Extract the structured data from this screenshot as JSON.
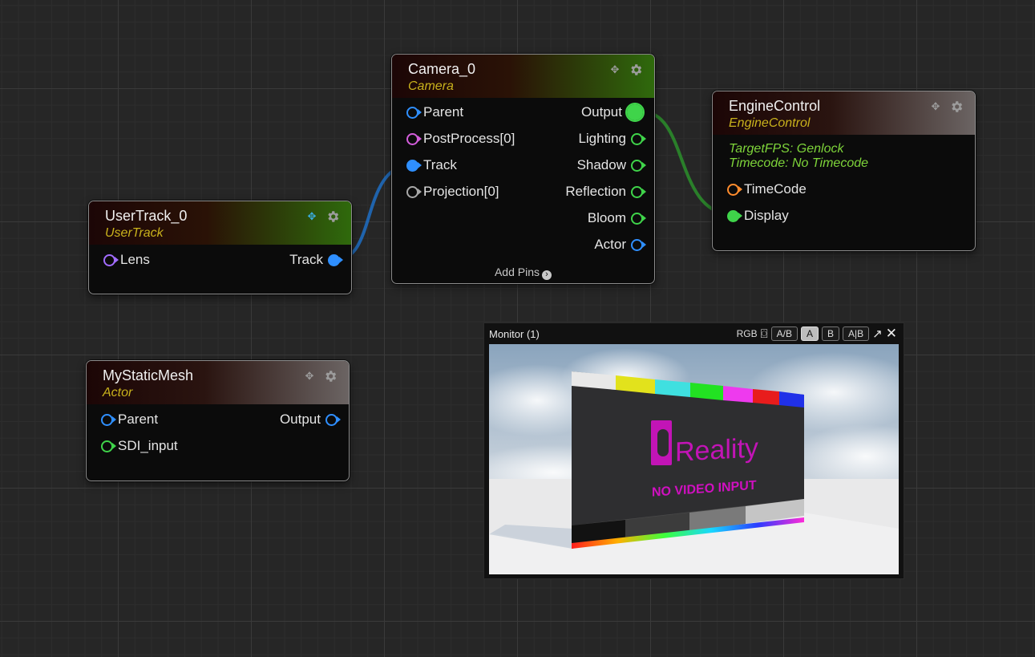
{
  "nodes": {
    "usertrack": {
      "title": "UserTrack_0",
      "type": "UserTrack",
      "pins_in": [
        {
          "label": "Lens",
          "color": "#a26cff"
        }
      ],
      "pins_out": [
        {
          "label": "Track",
          "color": "#2f8fff"
        }
      ]
    },
    "camera": {
      "title": "Camera_0",
      "type": "Camera",
      "pins_in": [
        {
          "label": "Parent",
          "color": "#2f8fff"
        },
        {
          "label": "PostProcess[0]",
          "color": "#d35ddb"
        },
        {
          "label": "Track",
          "color": "#2f8fff"
        },
        {
          "label": "Projection[0]",
          "color": "#a8a8a8"
        }
      ],
      "pins_out": [
        {
          "label": "Output",
          "color": "#3fd44a"
        },
        {
          "label": "Lighting",
          "color": "#3fd44a"
        },
        {
          "label": "Shadow",
          "color": "#3fd44a"
        },
        {
          "label": "Reflection",
          "color": "#3fd44a"
        },
        {
          "label": "Bloom",
          "color": "#3fd44a"
        },
        {
          "label": "Actor",
          "color": "#2f8fff"
        }
      ],
      "add_pins": "Add Pins"
    },
    "engine": {
      "title": "EngineControl",
      "type": "EngineControl",
      "status_fps": "TargetFPS: Genlock",
      "status_timecode": "Timecode: No Timecode",
      "pins_in": [
        {
          "label": "TimeCode",
          "color": "#ff8c2e"
        },
        {
          "label": "Display",
          "color": "#3fd44a"
        }
      ]
    },
    "mesh": {
      "title": "MyStaticMesh",
      "type": "Actor",
      "pins_in": [
        {
          "label": "Parent",
          "color": "#2f8fff"
        },
        {
          "label": "SDI_input",
          "color": "#3fd44a"
        }
      ],
      "pins_out": [
        {
          "label": "Output",
          "color": "#2f8fff"
        }
      ]
    }
  },
  "icons": {
    "move": "move-icon",
    "settings": "gear-icon",
    "compare_view": "screenshot-icon",
    "popout": "arrow-up-right-icon",
    "close": "close-icon"
  },
  "monitor": {
    "title": "Monitor (1)",
    "channel": "RGB",
    "buttons": [
      "A/B",
      "A",
      "B",
      "A|B"
    ],
    "active_button": "A",
    "screen_brand": "Reality",
    "screen_message": "NO VIDEO INPUT"
  },
  "colors": {
    "wire_blue": "#1f6fc4",
    "wire_green": "#2b8a2b",
    "brand_magenta": "#d010c0",
    "type_label": "#c9b21c",
    "status_text": "#7ed43a"
  }
}
